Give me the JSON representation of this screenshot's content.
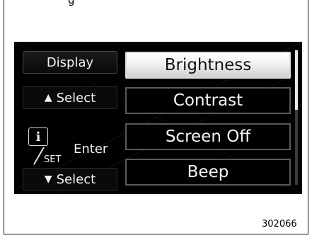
{
  "header_partial_text": "g",
  "sidebar": {
    "title": "Display",
    "select_up": {
      "icon": "up-triangle-icon",
      "label": "Select"
    },
    "enter": {
      "info_symbol": "i",
      "set_label": "SET",
      "label": "Enter"
    },
    "select_down": {
      "icon": "down-triangle-icon",
      "label": "Select"
    }
  },
  "menu": {
    "items": [
      {
        "label": "Brightness",
        "selected": true
      },
      {
        "label": "Contrast",
        "selected": false
      },
      {
        "label": "Screen Off",
        "selected": false
      },
      {
        "label": "Beep",
        "selected": false
      }
    ]
  },
  "scrollbar": {
    "position_fraction": 0.0,
    "visible_fraction": 0.44
  },
  "figure_number": "302066",
  "colors": {
    "screen_bg": "#000000",
    "selected_bg": "#f1f1f1",
    "text_light": "#f5f5f5"
  }
}
